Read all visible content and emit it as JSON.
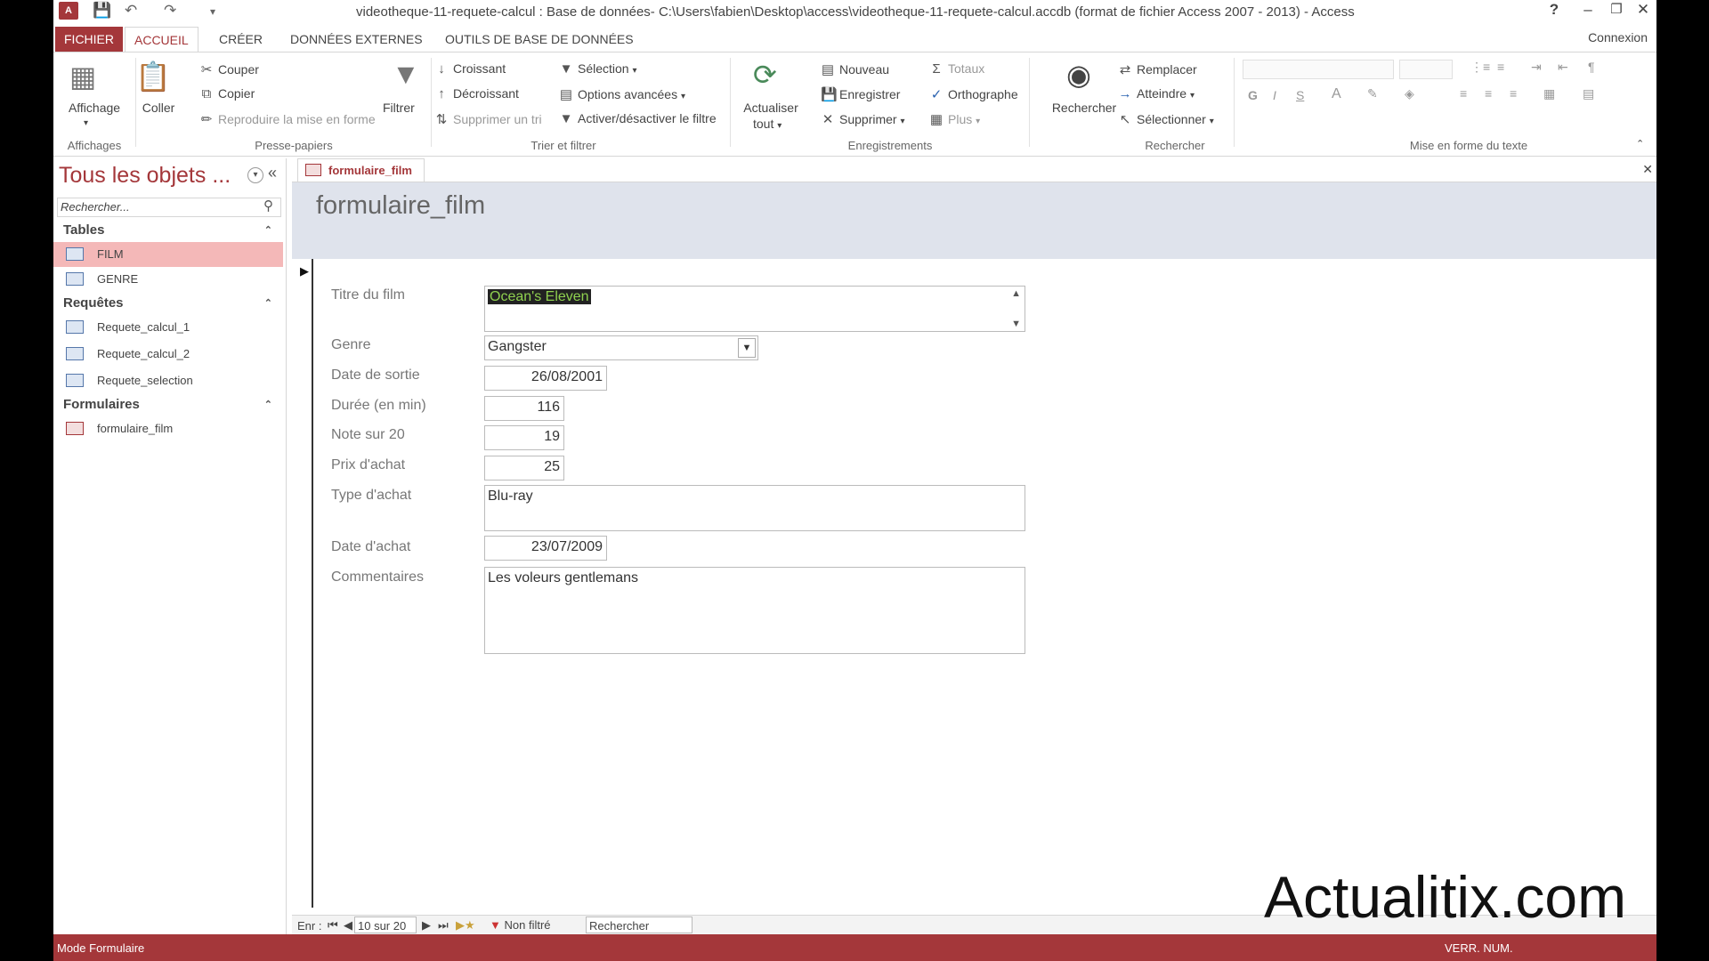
{
  "window": {
    "title": "videotheque-11-requete-calcul : Base de données- C:\\Users\\fabien\\Desktop\\access\\videotheque-11-requete-calcul.accdb (format de fichier Access 2007 - 2013) - Access",
    "app_logo": "A",
    "help": "?"
  },
  "ribbon_tabs": [
    "FICHIER",
    "ACCUEIL",
    "CRÉER",
    "DONNÉES EXTERNES",
    "OUTILS DE BASE DE DONNÉES"
  ],
  "connexion": "Connexion",
  "ribbon": {
    "affichage": "Affichage",
    "coller": "Coller",
    "couper": "Couper",
    "copier": "Copier",
    "reproduire": "Reproduire la mise en forme",
    "filtrer": "Filtrer",
    "croissant": "Croissant",
    "decroissant": "Décroissant",
    "supprimer_tri": "Supprimer un tri",
    "selection": "Sélection",
    "options_avancees": "Options avancées",
    "activer_filtre": "Activer/désactiver le filtre",
    "actualiser": "Actualiser",
    "tout": "tout",
    "nouveau": "Nouveau",
    "enregistrer": "Enregistrer",
    "supprimer": "Supprimer",
    "totaux": "Totaux",
    "orthographe": "Orthographe",
    "plus": "Plus",
    "rechercher": "Rechercher",
    "remplacer": "Remplacer",
    "atteindre": "Atteindre",
    "selectionner": "Sélectionner",
    "bold": "G",
    "italic": "I",
    "underline": "S",
    "font_color": "A",
    "groups": {
      "affichages": "Affichages",
      "presse_papiers": "Presse-papiers",
      "trier_filtrer": "Trier et filtrer",
      "enregistrements": "Enregistrements",
      "rechercher": "Rechercher",
      "mise_en_forme": "Mise en forme du texte"
    }
  },
  "nav": {
    "title": "Tous les objets ...",
    "search_placeholder": "Rechercher...",
    "sections": {
      "tables": "Tables",
      "requetes": "Requêtes",
      "formulaires": "Formulaires"
    },
    "tables": [
      "FILM",
      "GENRE"
    ],
    "requetes": [
      "Requete_calcul_1",
      "Requete_calcul_2",
      "Requete_selection"
    ],
    "formulaires": [
      "formulaire_film"
    ]
  },
  "doc_tab": "formulaire_film",
  "form": {
    "title": "formulaire_film",
    "fields": {
      "titre": {
        "label": "Titre du film",
        "value": "Ocean's Eleven"
      },
      "genre": {
        "label": "Genre",
        "value": "Gangster"
      },
      "date_sortie": {
        "label": "Date de sortie",
        "value": "26/08/2001"
      },
      "duree": {
        "label": "Durée (en min)",
        "value": "116"
      },
      "note": {
        "label": "Note sur 20",
        "value": "19"
      },
      "prix": {
        "label": "Prix d'achat",
        "value": "25"
      },
      "type": {
        "label": "Type d'achat",
        "value": "Blu-ray"
      },
      "date_achat": {
        "label": "Date d'achat",
        "value": "23/07/2009"
      },
      "commentaires": {
        "label": "Commentaires",
        "value": "Les voleurs gentlemans"
      }
    }
  },
  "record_nav": {
    "label": "Enr :",
    "current": "10 sur 20",
    "filter": "Non filtré",
    "search": "Rechercher"
  },
  "status": {
    "mode": "Mode Formulaire",
    "verr_num": "VERR. NUM."
  },
  "watermark": "Actualitix.com"
}
